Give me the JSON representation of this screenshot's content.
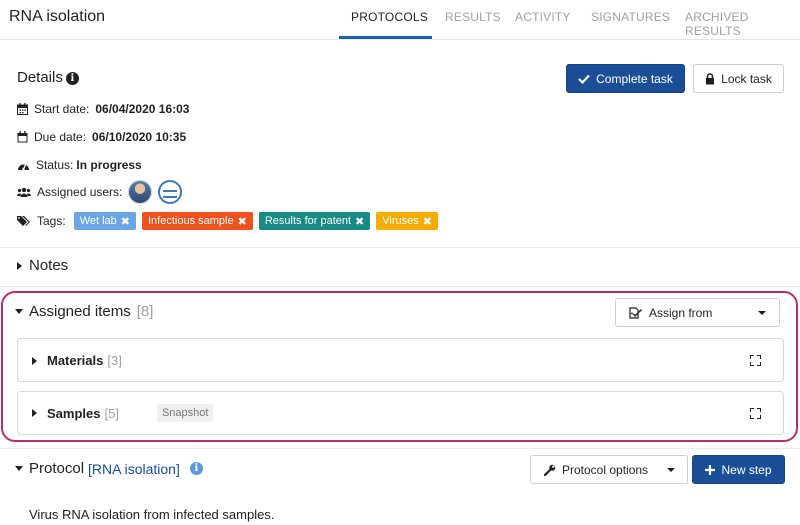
{
  "header": {
    "title": "RNA isolation",
    "tabs": [
      {
        "label": "PROTOCOLS",
        "active": true
      },
      {
        "label": "RESULTS",
        "active": false
      },
      {
        "label": "ACTIVITY",
        "active": false
      },
      {
        "label": "SIGNATURES",
        "active": false
      },
      {
        "label": "ARCHIVED RESULTS",
        "active": false
      }
    ]
  },
  "details": {
    "title": "Details",
    "complete_label": "Complete task",
    "lock_label": "Lock task",
    "start_label": "Start date:",
    "start_value": "06/04/2020 16:03",
    "due_label": "Due date:",
    "due_value": "06/10/2020 10:35",
    "status_label": "Status:",
    "status_value": "In progress",
    "assigned_label": "Assigned users:",
    "tags_label": "Tags:",
    "tags": [
      {
        "label": "Wet lab",
        "color": "#6aa5e6"
      },
      {
        "label": "Infectious sample",
        "color": "#f0521e"
      },
      {
        "label": "Results for patent",
        "color": "#168a83"
      },
      {
        "label": "Viruses",
        "color": "#f5ac00"
      }
    ]
  },
  "notes": {
    "title": "Notes"
  },
  "assigned_items": {
    "title": "Assigned items",
    "count": "[8]",
    "assign_from_label": "Assign from",
    "materials": {
      "label": "Materials",
      "count": "[3]"
    },
    "samples": {
      "label": "Samples",
      "count": "[5]",
      "badge": "Snapshot"
    }
  },
  "protocol": {
    "title": "Protocol",
    "link": "[RNA isolation]",
    "options_label": "Protocol options",
    "new_step_label": "New step",
    "description": "Virus RNA isolation from infected samples."
  },
  "colors": {
    "primary": "#1a4f98",
    "highlight": "#b5306b",
    "tab_active": "#1a61b1"
  }
}
